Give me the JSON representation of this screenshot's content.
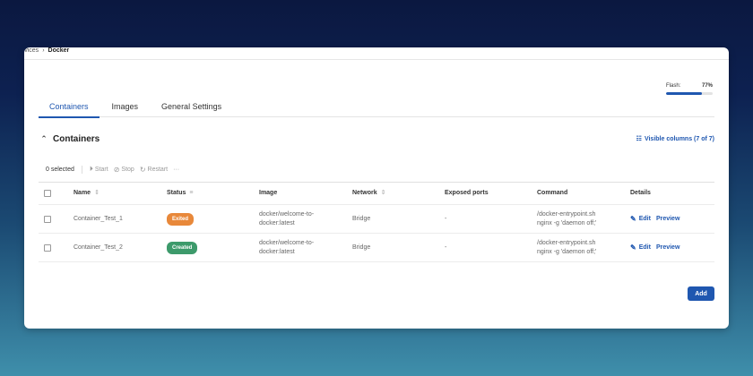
{
  "breadcrumb": {
    "prev": "ervices",
    "separator": "›",
    "current": "Docker"
  },
  "flash": {
    "label": "Flash:",
    "value": "77%",
    "percent": 77
  },
  "tabs": [
    {
      "label": "Containers",
      "active": true
    },
    {
      "label": "Images",
      "active": false
    },
    {
      "label": "General Settings",
      "active": false
    }
  ],
  "section": {
    "chevron_icon": "chevron-up-icon",
    "title": "Containers",
    "visible_columns": "Visible columns (7 of 7)"
  },
  "toolbar": {
    "selected": "0 selected",
    "start": "Start",
    "stop": "Stop",
    "restart": "Restart",
    "more": "···"
  },
  "table": {
    "headers": {
      "name": "Name",
      "status": "Status",
      "image": "Image",
      "network": "Network",
      "ports": "Exposed ports",
      "command": "Command",
      "details": "Details"
    },
    "rows": [
      {
        "name": "Container_Test_1",
        "status": "Exited",
        "status_color": "#e8883a",
        "image": "docker/welcome-to-docker:latest",
        "network": "Bridge",
        "ports": "-",
        "command": "/docker-entrypoint.sh nginx -g 'daemon off;'",
        "edit": "Edit",
        "preview": "Preview"
      },
      {
        "name": "Container_Test_2",
        "status": "Created",
        "status_color": "#3d9a6b",
        "image": "docker/welcome-to-docker:latest",
        "network": "Bridge",
        "ports": "-",
        "command": "/docker-entrypoint.sh nginx -g 'daemon off;'",
        "edit": "Edit",
        "preview": "Preview"
      }
    ]
  },
  "add_button": "Add",
  "colors": {
    "accent": "#1f57b0",
    "exited": "#e8883a",
    "created": "#3d9a6b"
  }
}
